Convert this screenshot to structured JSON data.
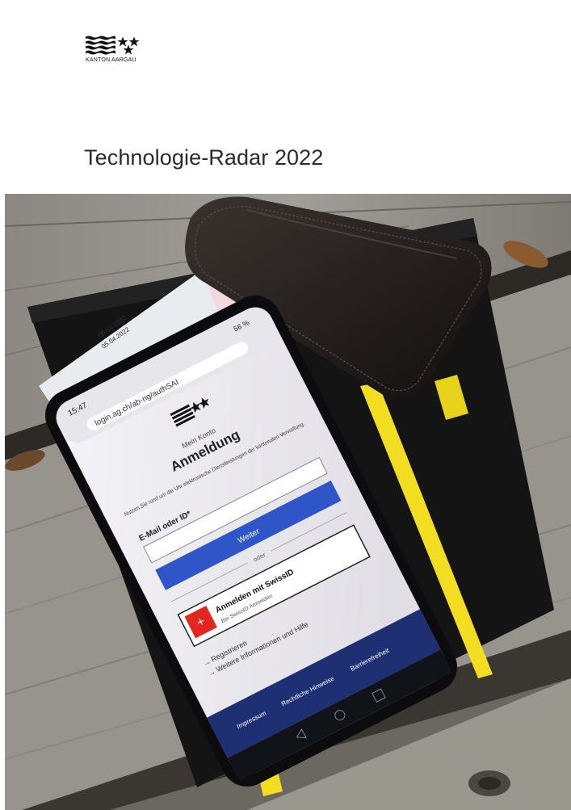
{
  "header": {
    "logo_caption": "KANTON AARGAU",
    "title": "Technologie-Radar 2022"
  },
  "cover_photo": {
    "phone": {
      "status_time": "15:47",
      "url": "login.ag.ch/ab-ng/authSAI",
      "battery": "56 %",
      "screen_section": "Mein Konto",
      "screen_heading": "Anmeldung",
      "intro_text": "Nutzen Sie rund um die Uhr elektronische Dienstleistungen der kantonalen Verwaltung.",
      "email_label": "E-Mail oder ID*",
      "submit_label": "Weiter",
      "divider_label": "oder",
      "swissid_label": "Anmelden mit SwissID",
      "swissid_hint": "Bei SwissID Anmelden",
      "link_register": "→ Registrieren",
      "link_info": "→ Weitere Informationen und Hilfe",
      "footer_links": [
        "Impressum",
        "Rechtliche Hinweise",
        "Barrierefreiheit"
      ]
    },
    "card_date_1": "05.04.2022",
    "card_date_2": "05.04.2022",
    "colors": {
      "accent_blue": "#2f56c9",
      "swissid_red": "#e3261f",
      "band_yellow": "#f2dd21"
    }
  }
}
